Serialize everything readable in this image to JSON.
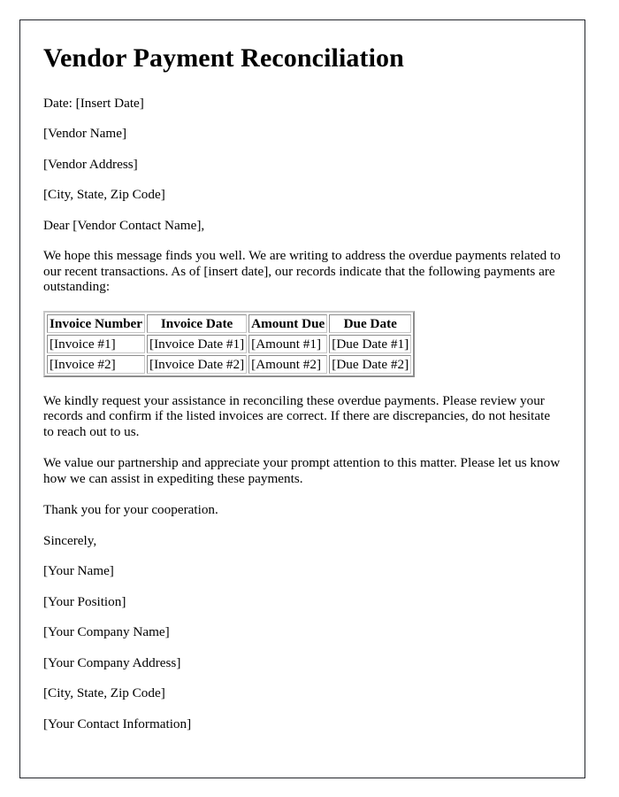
{
  "document": {
    "title": "Vendor Payment Reconciliation",
    "date_line": "Date: [Insert Date]",
    "vendor_name": "[Vendor Name]",
    "vendor_address": "[Vendor Address]",
    "vendor_city_state_zip": "[City, State, Zip Code]",
    "salutation": "Dear [Vendor Contact Name],",
    "intro_paragraph": "We hope this message finds you well. We are writing to address the overdue payments related to our recent transactions. As of [insert date], our records indicate that the following payments are outstanding:",
    "request_paragraph": "We kindly request your assistance in reconciling these overdue payments. Please review your records and confirm if the listed invoices are correct. If there are discrepancies, do not hesitate to reach out to us.",
    "value_paragraph": "We value our partnership and appreciate your prompt attention to this matter. Please let us know how we can assist in expediting these payments.",
    "thanks_paragraph": "Thank you for your cooperation.",
    "closing": "Sincerely,",
    "signature": {
      "your_name": "[Your Name]",
      "your_position": "[Your Position]",
      "your_company_name": "[Your Company Name]",
      "your_company_address": "[Your Company Address]",
      "your_city_state_zip": "[City, State, Zip Code]",
      "your_contact_information": "[Your Contact Information]"
    }
  },
  "invoice_table": {
    "headers": [
      "Invoice Number",
      "Invoice Date",
      "Amount Due",
      "Due Date"
    ],
    "rows": [
      [
        "[Invoice #1]",
        "[Invoice Date #1]",
        "[Amount #1]",
        "[Due Date #1]"
      ],
      [
        "[Invoice #2]",
        "[Invoice Date #2]",
        "[Amount #2]",
        "[Due Date #2]"
      ]
    ]
  },
  "colors": {
    "text": "#000000",
    "page_border": "#23252b",
    "background": "#ffffff",
    "table_border_light": "#c6c6c6",
    "table_border_dark": "#8d8d8d"
  }
}
